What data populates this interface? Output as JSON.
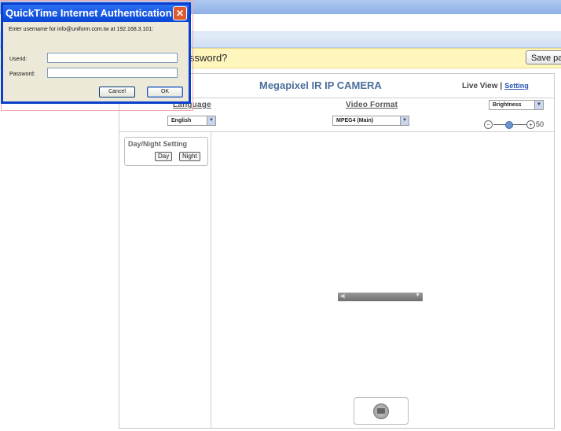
{
  "browser": {
    "save_password_prompt": "ssword?",
    "save_password_button": "Save pass"
  },
  "dialog": {
    "title": "QuickTime Internet Authentication",
    "prompt": "Enter username for info@uniform.com.tw at 192.168.3.101:",
    "userid_label": "Userid:",
    "password_label": "Password:",
    "userid_value": "",
    "password_value": "",
    "cancel_label": "Cancel",
    "ok_label": "OK",
    "close_symbol": "✕"
  },
  "camera": {
    "title": "Megapixel IR IP CAMERA",
    "nav_live_view": "Live View",
    "nav_separator": "|",
    "nav_setting": "Setting",
    "language_label": "Language",
    "language_value": "English",
    "video_format_label": "Video Format",
    "video_format_value": "MPEG4 (Main)",
    "image_param_value": "Brightness",
    "slider_minus": "−",
    "slider_plus": "+",
    "brightness_value": "50",
    "daynight_title": "Day/Night Setting",
    "day_button": "Day",
    "night_button": "Night"
  },
  "icons": {
    "dropdown_arrow": "▼",
    "volume": "◀)",
    "player_menu": "▼"
  }
}
